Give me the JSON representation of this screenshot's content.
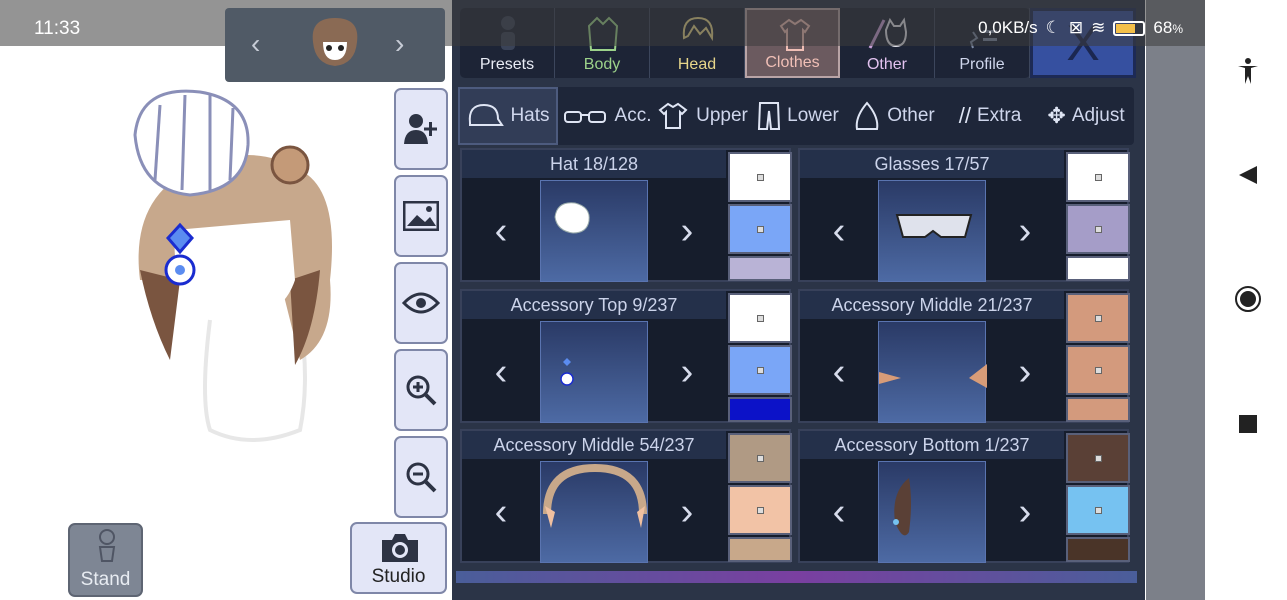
{
  "status_bar": {
    "time": "11:33",
    "network_speed": "0,0KB/s",
    "battery_percent": "68",
    "battery_suffix": "%",
    "battery_level": 0.68
  },
  "top_tabs": [
    {
      "label": "Presets",
      "icon": "person-silhouette-icon",
      "active": false
    },
    {
      "label": "Body",
      "icon": "jacket-icon",
      "active": false
    },
    {
      "label": "Head",
      "icon": "hair-icon",
      "active": false
    },
    {
      "label": "Clothes",
      "icon": "shirt-icon",
      "active": true
    },
    {
      "label": "Other",
      "icon": "sword-cat-icon",
      "active": false
    },
    {
      "label": "Profile",
      "icon": "profile-card-icon",
      "active": false
    }
  ],
  "close_label": "X",
  "sub_tabs": [
    {
      "label": "Hats",
      "icon": "cap-icon",
      "active": true
    },
    {
      "label": "Acc.",
      "icon": "glasses-icon",
      "active": false
    },
    {
      "label": "Upper",
      "icon": "tshirt-icon",
      "active": false
    },
    {
      "label": "Lower",
      "icon": "pants-icon",
      "active": false
    },
    {
      "label": "Other",
      "icon": "wing-icon",
      "active": false
    },
    {
      "label": "Extra",
      "icon": "slashes-icon",
      "active": false
    },
    {
      "label": "Adjust",
      "icon": "move-arrows-icon",
      "active": false
    }
  ],
  "cards": [
    {
      "title": "Hat 18/128",
      "swatches": [
        "#ffffff",
        "#7aa6f7",
        "#b9b3d6"
      ]
    },
    {
      "title": "Glasses 17/57",
      "swatches": [
        "#ffffff",
        "#a59dc8",
        "#ffffff"
      ]
    },
    {
      "title": "Accessory Top 9/237",
      "swatches": [
        "#ffffff",
        "#7aa6f7",
        "#0c12c8"
      ]
    },
    {
      "title": "Accessory Middle 21/237",
      "swatches": [
        "#d39a7d",
        "#d39a7d",
        "#d39a7d"
      ]
    },
    {
      "title": "Accessory Middle 54/237",
      "swatches": [
        "#b09a84",
        "#f2c3a6",
        "#c8a88a"
      ]
    },
    {
      "title": "Accessory Bottom 1/237",
      "swatches": [
        "#5a4036",
        "#76c2f1",
        "#4a3428"
      ]
    }
  ],
  "left_tools": [
    {
      "name": "add-character-button",
      "icon": "add-person-icon"
    },
    {
      "name": "background-button",
      "icon": "image-icon"
    },
    {
      "name": "visibility-button",
      "icon": "eye-icon"
    },
    {
      "name": "zoom-in-button",
      "icon": "zoom-in-icon"
    },
    {
      "name": "zoom-out-button",
      "icon": "zoom-out-icon"
    }
  ],
  "stand_label": "Stand",
  "studio_label": "Studio",
  "head_nav": {
    "prev": "‹",
    "next": "›"
  },
  "arrows": {
    "prev": "‹",
    "next": "›"
  }
}
